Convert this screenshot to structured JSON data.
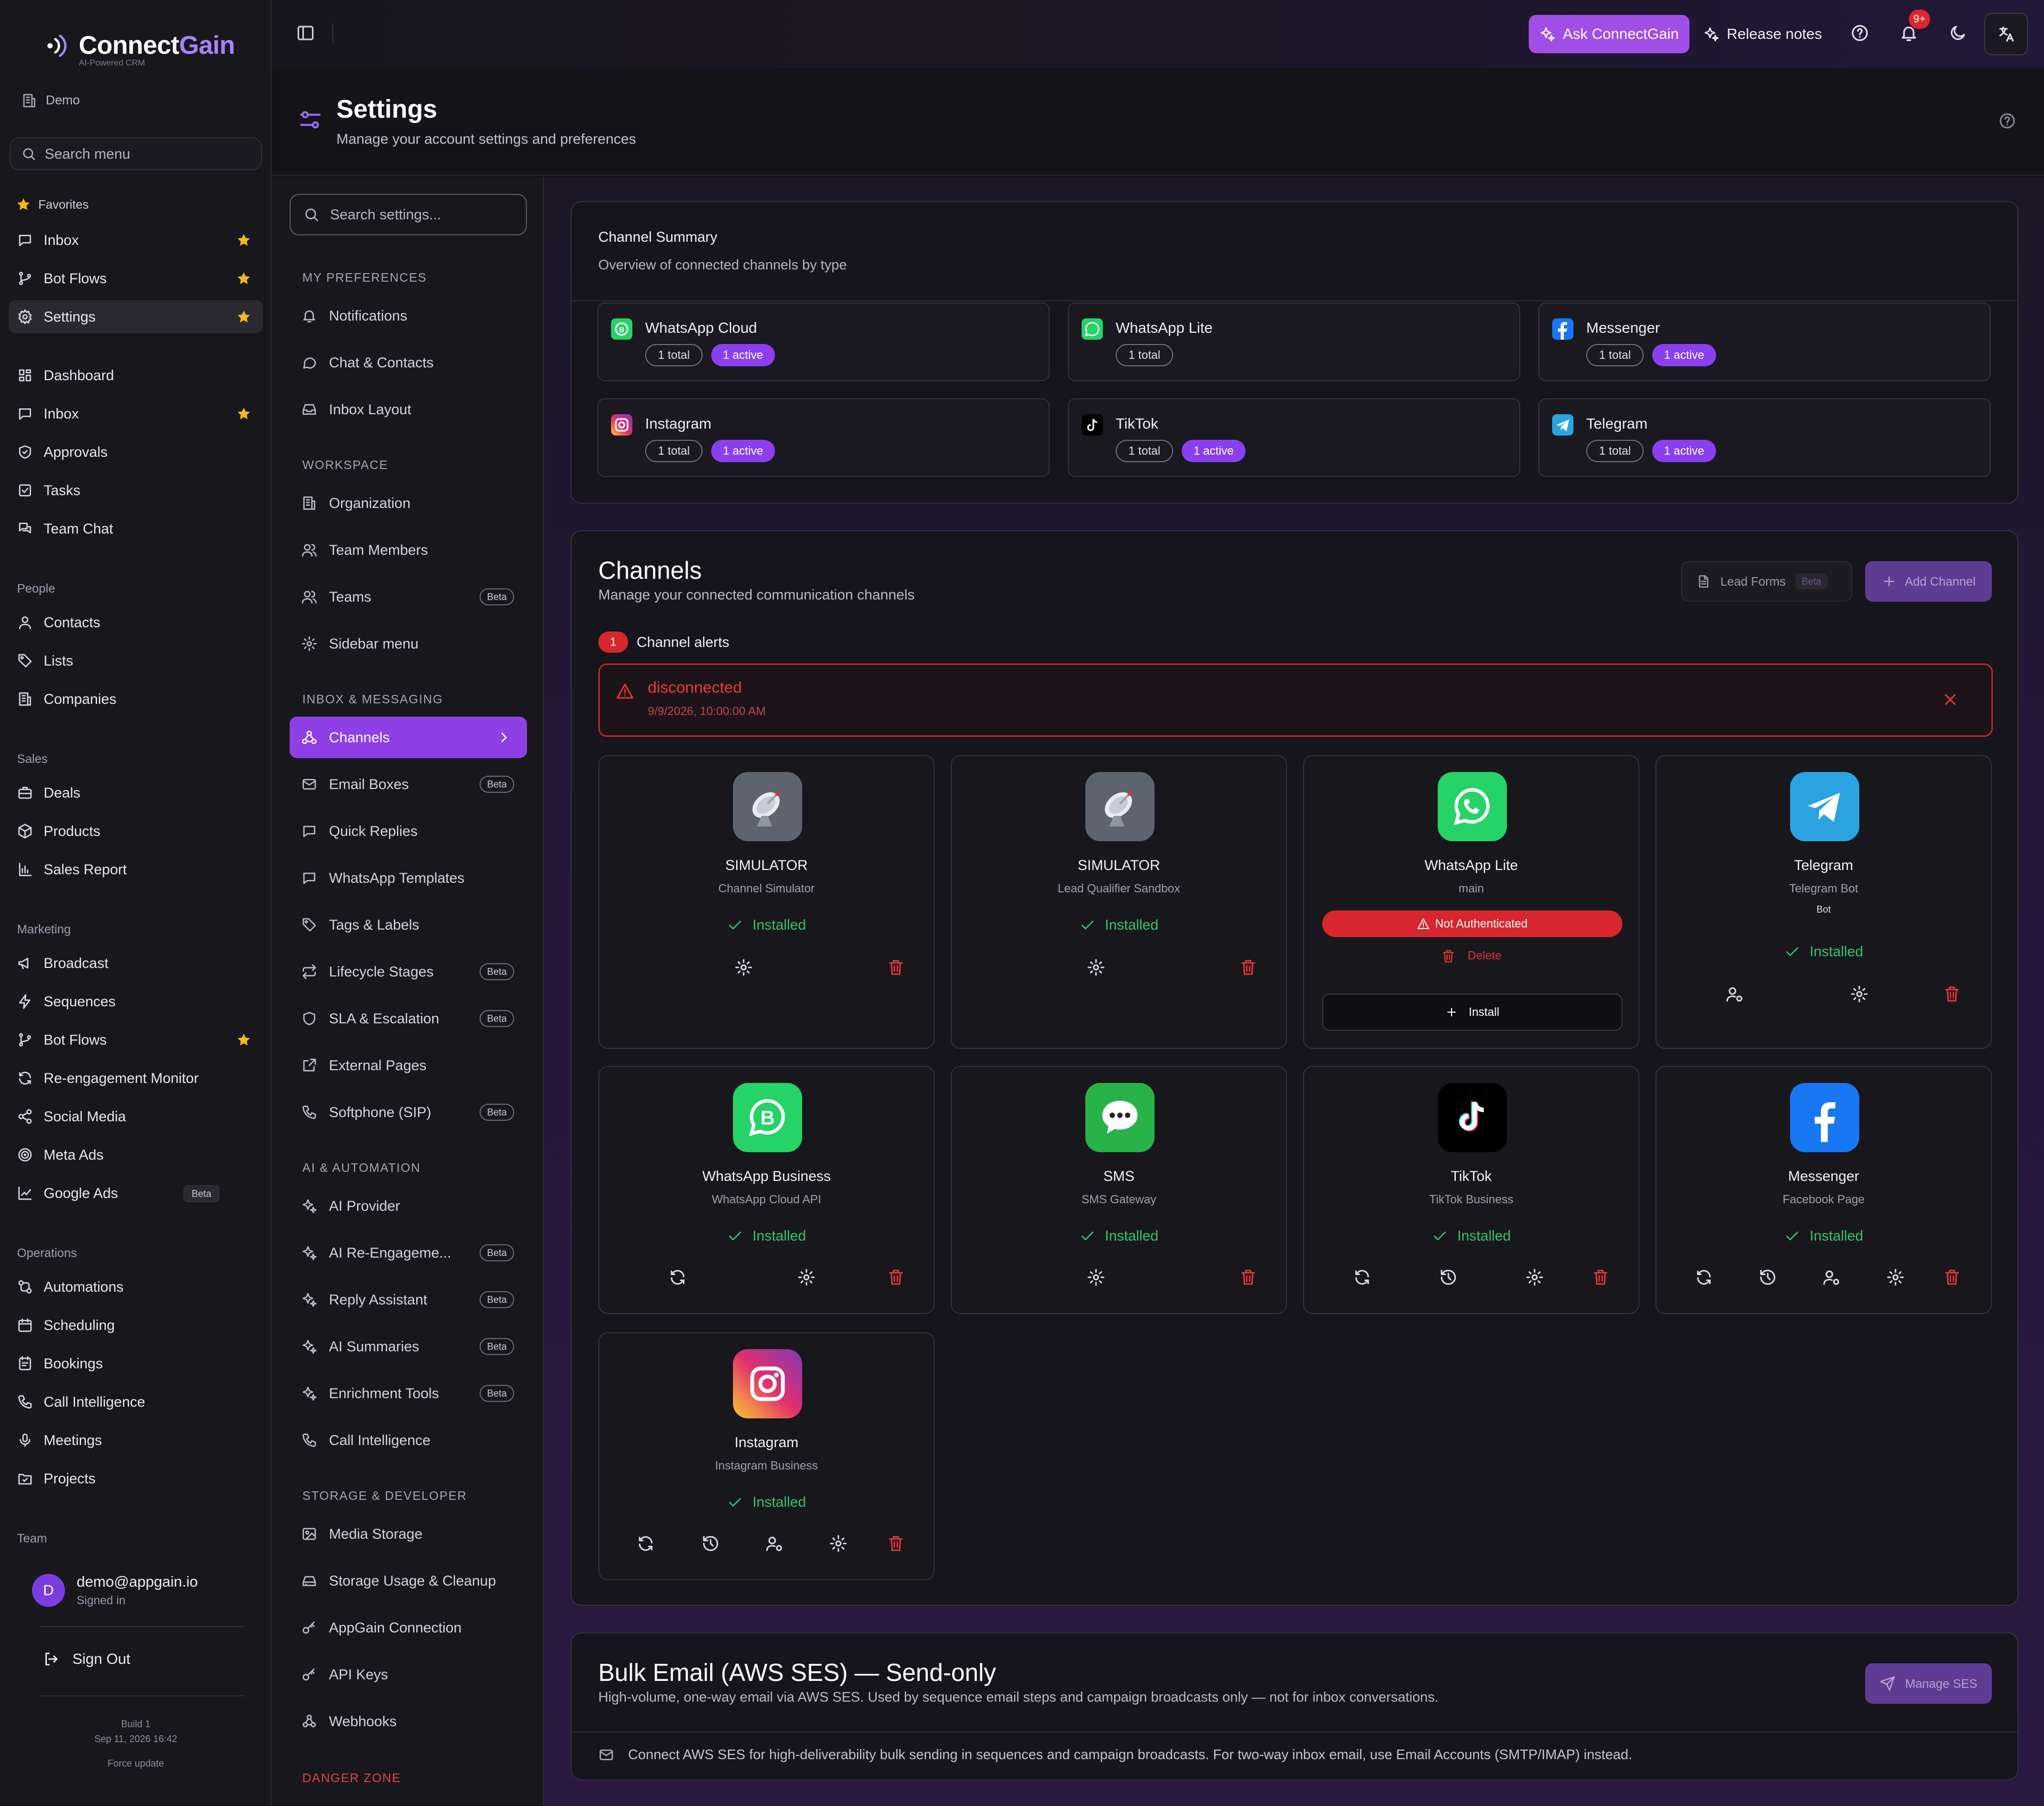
{
  "brand": {
    "name_part1": "Connect",
    "name_part2": "Gain",
    "tagline": "AI-Powered CRM",
    "workspace": "Demo"
  },
  "sidebar": {
    "search_placeholder": "Search menu",
    "favorites_title": "Favorites",
    "favorites": [
      {
        "label": "Inbox"
      },
      {
        "label": "Bot Flows"
      },
      {
        "label": "Settings"
      }
    ],
    "main": [
      {
        "label": "Dashboard"
      },
      {
        "label": "Inbox"
      },
      {
        "label": "Approvals"
      },
      {
        "label": "Tasks"
      },
      {
        "label": "Team Chat"
      }
    ],
    "people_title": "People",
    "people": [
      {
        "label": "Contacts"
      },
      {
        "label": "Lists"
      },
      {
        "label": "Companies"
      }
    ],
    "sales_title": "Sales",
    "sales": [
      {
        "label": "Deals"
      },
      {
        "label": "Products"
      },
      {
        "label": "Sales Report"
      }
    ],
    "marketing_title": "Marketing",
    "marketing": [
      {
        "label": "Broadcast"
      },
      {
        "label": "Sequences"
      },
      {
        "label": "Bot Flows"
      },
      {
        "label": "Re-engagement Monitor"
      },
      {
        "label": "Social Media"
      },
      {
        "label": "Meta Ads"
      },
      {
        "label": "Google Ads",
        "badge": "Beta"
      }
    ],
    "operations_title": "Operations",
    "operations": [
      {
        "label": "Automations"
      },
      {
        "label": "Scheduling"
      },
      {
        "label": "Bookings"
      },
      {
        "label": "Call Intelligence"
      },
      {
        "label": "Meetings"
      },
      {
        "label": "Projects"
      }
    ],
    "team_title": "Team",
    "user": {
      "initial": "D",
      "email": "demo@appgain.io",
      "status": "Signed in"
    },
    "sign_out": "Sign Out",
    "build": {
      "line1": "Build 1",
      "line2": "Sep 11, 2026 16:42",
      "line3": "Force update"
    }
  },
  "topbar": {
    "ask": "Ask ConnectGain",
    "release_notes": "Release notes",
    "notif_count": "9+"
  },
  "header": {
    "title": "Settings",
    "subtitle": "Manage your account settings and preferences"
  },
  "settings_nav": {
    "search_placeholder": "Search settings...",
    "groups": [
      {
        "title": "MY PREFERENCES",
        "items": [
          {
            "label": "Notifications"
          },
          {
            "label": "Chat & Contacts"
          },
          {
            "label": "Inbox Layout"
          }
        ]
      },
      {
        "title": "WORKSPACE",
        "items": [
          {
            "label": "Organization"
          },
          {
            "label": "Team Members"
          },
          {
            "label": "Teams",
            "badge": "Beta"
          },
          {
            "label": "Sidebar menu"
          }
        ]
      },
      {
        "title": "INBOX & MESSAGING",
        "items": [
          {
            "label": "Channels"
          },
          {
            "label": "Email Boxes",
            "badge": "Beta"
          },
          {
            "label": "Quick Replies"
          },
          {
            "label": "WhatsApp Templates"
          },
          {
            "label": "Tags & Labels"
          },
          {
            "label": "Lifecycle Stages",
            "badge": "Beta"
          },
          {
            "label": "SLA & Escalation",
            "badge": "Beta"
          },
          {
            "label": "External Pages"
          },
          {
            "label": "Softphone (SIP)",
            "badge": "Beta"
          }
        ]
      },
      {
        "title": "AI & AUTOMATION",
        "items": [
          {
            "label": "AI Provider"
          },
          {
            "label": "AI Re-Engageme...",
            "badge": "Beta"
          },
          {
            "label": "Reply Assistant",
            "badge": "Beta"
          },
          {
            "label": "AI Summaries",
            "badge": "Beta"
          },
          {
            "label": "Enrichment Tools",
            "badge": "Beta"
          },
          {
            "label": "Call Intelligence"
          }
        ]
      },
      {
        "title": "STORAGE & DEVELOPER",
        "items": [
          {
            "label": "Media Storage"
          },
          {
            "label": "Storage Usage & Cleanup"
          },
          {
            "label": "AppGain Connection"
          },
          {
            "label": "API Keys"
          },
          {
            "label": "Webhooks"
          }
        ]
      },
      {
        "title": "DANGER ZONE",
        "items": []
      }
    ]
  },
  "summary": {
    "title": "Channel Summary",
    "subtitle": "Overview of connected channels by type",
    "tiles": [
      {
        "name": "WhatsApp Cloud",
        "total": "1 total",
        "active": "1 active"
      },
      {
        "name": "WhatsApp Lite",
        "total": "1 total",
        "active": ""
      },
      {
        "name": "Messenger",
        "total": "1 total",
        "active": "1 active"
      },
      {
        "name": "Instagram",
        "total": "1 total",
        "active": "1 active"
      },
      {
        "name": "TikTok",
        "total": "1 total",
        "active": "1 active"
      },
      {
        "name": "Telegram",
        "total": "1 total",
        "active": "1 active"
      }
    ]
  },
  "channels": {
    "title": "Channels",
    "subtitle": "Manage your connected communication channels",
    "lead_forms": "Lead Forms",
    "lead_forms_badge": "Beta",
    "add_channel": "Add Channel",
    "alerts_count": "1",
    "alerts_title": "Channel alerts",
    "alert": {
      "message": "disconnected",
      "time": "9/9/2026, 10:00:00 AM"
    },
    "installed_label": "Installed",
    "cards": [
      {
        "name": "SIMULATOR",
        "sub": "Channel Simulator",
        "icon": "satellite-dish"
      },
      {
        "name": "SIMULATOR",
        "sub": "Lead Qualifier Sandbox",
        "icon": "satellite-dish"
      },
      {
        "name": "WhatsApp Lite",
        "sub": "main",
        "icon": "whatsapp",
        "status": "Not Authenticated",
        "delete": "Delete",
        "install": "Install"
      },
      {
        "name": "Telegram",
        "sub": "Telegram Bot",
        "badge": "Bot",
        "icon": "telegram"
      },
      {
        "name": "WhatsApp Business",
        "sub": "WhatsApp Cloud API",
        "icon": "whatsapp-business"
      },
      {
        "name": "SMS",
        "sub": "SMS Gateway",
        "icon": "sms-bubble"
      },
      {
        "name": "TikTok",
        "sub": "TikTok Business",
        "icon": "tiktok"
      },
      {
        "name": "Messenger",
        "sub": "Facebook Page",
        "icon": "facebook"
      },
      {
        "name": "Instagram",
        "sub": "Instagram Business",
        "icon": "instagram"
      }
    ]
  },
  "bulk": {
    "title": "Bulk Email (AWS SES) — Send-only",
    "subtitle": "High-volume, one-way email via AWS SES. Used by sequence email steps and campaign broadcasts only — not for inbox conversations.",
    "manage": "Manage SES",
    "note": "Connect AWS SES for high-deliverability bulk sending in sequences and campaign broadcasts. For two-way inbox email, use Email Accounts (SMTP/IMAP) instead."
  },
  "colors": {
    "accent": "#8f3fe6",
    "installed": "#35c46d",
    "danger": "#d7262d"
  }
}
